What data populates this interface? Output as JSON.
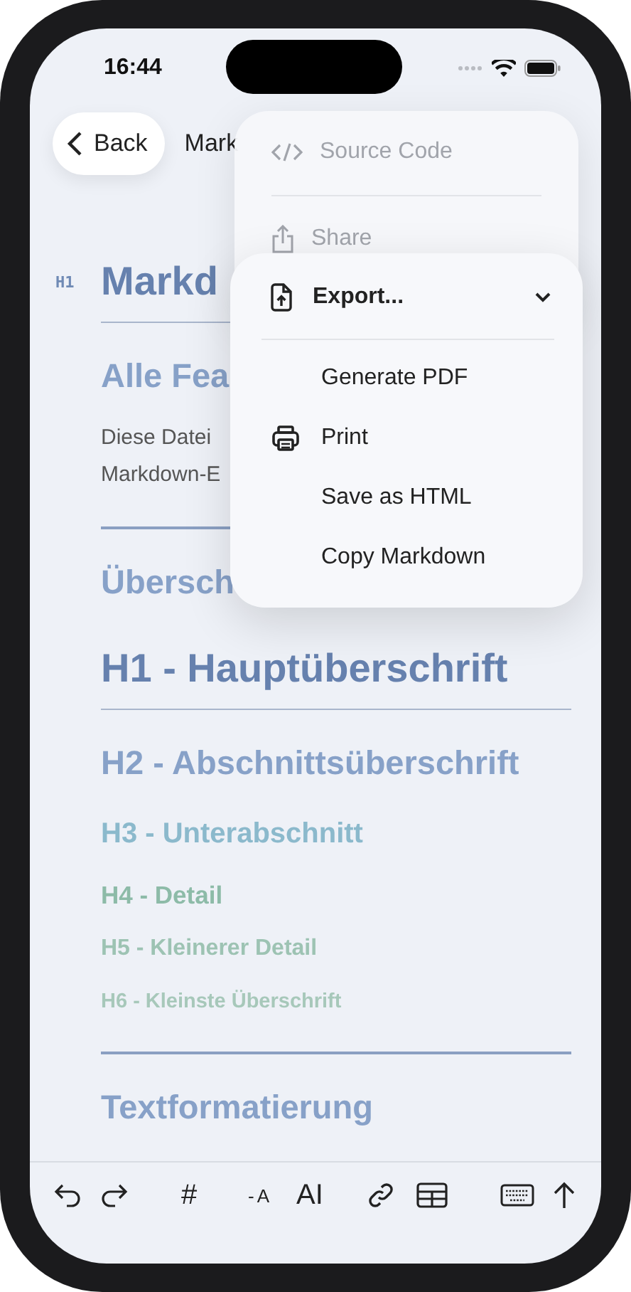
{
  "status_bar": {
    "time": "16:44"
  },
  "nav": {
    "back": "Back",
    "title": "Mark"
  },
  "document": {
    "blocks": [
      {
        "kind": "h1",
        "marker": "H1",
        "text": "Markd"
      },
      {
        "kind": "underline"
      },
      {
        "kind": "h2",
        "text": "Alle Fea"
      },
      {
        "kind": "p",
        "lines": [
          "Diese Datei",
          "Markdown-E"
        ]
      },
      {
        "kind": "rule"
      },
      {
        "kind": "h2",
        "text": "Übersch"
      },
      {
        "kind": "h1",
        "text": "H1 - Hauptüberschrift"
      },
      {
        "kind": "underline"
      },
      {
        "kind": "h2",
        "text": "H2 - Abschnittsüberschrift"
      },
      {
        "kind": "h3",
        "text": "H3 - Unterabschnitt"
      },
      {
        "kind": "h4",
        "text": "H4 - Detail"
      },
      {
        "kind": "h5",
        "text": "H5 - Kleinerer Detail"
      },
      {
        "kind": "h6",
        "text": "H6 - Kleinste Überschrift"
      },
      {
        "kind": "rule"
      },
      {
        "kind": "h2",
        "text": "Textformatierung"
      }
    ]
  },
  "menu": {
    "items": [
      {
        "label": "Source Code"
      },
      {
        "label": "Share"
      }
    ]
  },
  "submenu": {
    "title": "Export...",
    "expanded": true,
    "items": [
      {
        "label": "Generate PDF"
      },
      {
        "label": "Print"
      },
      {
        "label": "Save as HTML"
      },
      {
        "label": "Copy Markdown"
      }
    ]
  },
  "toolbar": {
    "items": [
      {
        "kind": "icon"
      },
      {
        "kind": "icon"
      },
      {
        "kind": "text",
        "label": "#"
      },
      {
        "kind": "text",
        "label": "-A"
      },
      {
        "kind": "text",
        "label": "AI"
      },
      {
        "kind": "icon"
      },
      {
        "kind": "icon"
      },
      {
        "kind": "icon"
      },
      {
        "kind": "icon"
      }
    ]
  }
}
